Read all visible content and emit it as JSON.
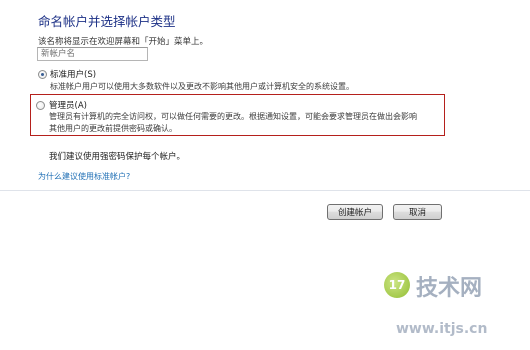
{
  "page": {
    "title": "命名帐户并选择帐户类型",
    "instruction": "该名称将显示在欢迎屏幕和「开始」菜单上。"
  },
  "name_field": {
    "value": "",
    "placeholder": "新帐户名"
  },
  "account_types": [
    {
      "label": "标准用户(S)",
      "selected": true,
      "description": "标准帐户用户可以使用大多数软件以及更改不影响其他用户或计算机安全的系统设置。"
    },
    {
      "label": "管理员(A)",
      "selected": false,
      "description_line1": "管理员有计算机的完全访问权，可以做任何需要的更改。根据通知设置，可能会要求管理员在做出会影响",
      "description_line2": "其他用户的更改前提供密码或确认。"
    }
  ],
  "note": "我们建议使用强密码保护每个帐户。",
  "help_link": "为什么建议使用标准帐户?",
  "buttons": {
    "create": "创建帐户",
    "cancel": "取消"
  },
  "watermark": {
    "badge": "17",
    "text": "技术网",
    "url": "www.itjs.cn"
  },
  "colors": {
    "title": "#1e3287",
    "link": "#1f6fb5",
    "highlight_border": "#b5201c"
  }
}
